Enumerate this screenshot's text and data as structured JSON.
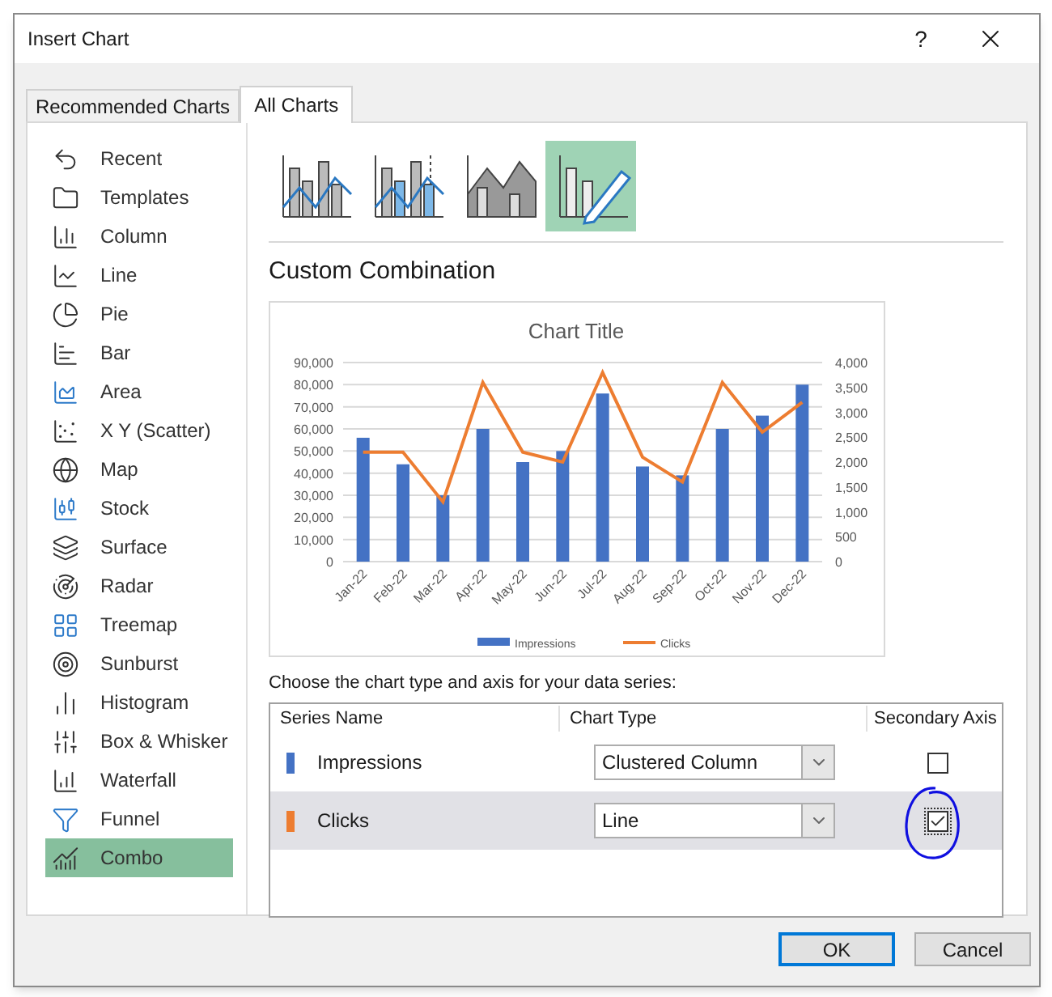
{
  "window": {
    "title": "Insert Chart",
    "help_label": "?"
  },
  "tabs": [
    {
      "label": "Recommended Charts",
      "selected": false
    },
    {
      "label": "All Charts",
      "selected": true
    }
  ],
  "sidebar": {
    "items": [
      {
        "label": "Recent",
        "selected": false
      },
      {
        "label": "Templates",
        "selected": false
      },
      {
        "label": "Column",
        "selected": false
      },
      {
        "label": "Line",
        "selected": false
      },
      {
        "label": "Pie",
        "selected": false
      },
      {
        "label": "Bar",
        "selected": false
      },
      {
        "label": "Area",
        "selected": false
      },
      {
        "label": "X Y (Scatter)",
        "selected": false
      },
      {
        "label": "Map",
        "selected": false
      },
      {
        "label": "Stock",
        "selected": false
      },
      {
        "label": "Surface",
        "selected": false
      },
      {
        "label": "Radar",
        "selected": false
      },
      {
        "label": "Treemap",
        "selected": false
      },
      {
        "label": "Sunburst",
        "selected": false
      },
      {
        "label": "Histogram",
        "selected": false
      },
      {
        "label": "Box & Whisker",
        "selected": false
      },
      {
        "label": "Waterfall",
        "selected": false
      },
      {
        "label": "Funnel",
        "selected": false
      },
      {
        "label": "Combo",
        "selected": true
      }
    ]
  },
  "subtypes": [
    {
      "selected": false
    },
    {
      "selected": false
    },
    {
      "selected": false
    },
    {
      "selected": true
    }
  ],
  "heading": "Custom Combination",
  "preview": {
    "chart_data": {
      "type": "bar",
      "title": "Chart Title",
      "categories": [
        "Jan-22",
        "Feb-22",
        "Mar-22",
        "Apr-22",
        "May-22",
        "Jun-22",
        "Jul-22",
        "Aug-22",
        "Sep-22",
        "Oct-22",
        "Nov-22",
        "Dec-22"
      ],
      "series": [
        {
          "name": "Impressions",
          "color": "#4472c4",
          "values": [
            56000,
            44000,
            30000,
            60000,
            45000,
            50000,
            76000,
            43000,
            39000,
            60000,
            66000,
            80000
          ]
        },
        {
          "name": "Clicks",
          "type": "line",
          "axis": "y2",
          "color": "#ed7d31",
          "values": [
            2200,
            2200,
            1200,
            3600,
            2200,
            2000,
            3800,
            2100,
            1600,
            3600,
            2600,
            3200
          ]
        }
      ],
      "grid": true,
      "legend": "bottom",
      "ylim": [
        0,
        90000
      ],
      "yticks": [
        {
          "value": 0,
          "label": "0"
        },
        {
          "value": 10000,
          "label": "10,000"
        },
        {
          "value": 20000,
          "label": "20,000"
        },
        {
          "value": 30000,
          "label": "30,000"
        },
        {
          "value": 40000,
          "label": "40,000"
        },
        {
          "value": 50000,
          "label": "50,000"
        },
        {
          "value": 60000,
          "label": "60,000"
        },
        {
          "value": 70000,
          "label": "70,000"
        },
        {
          "value": 80000,
          "label": "80,000"
        },
        {
          "value": 90000,
          "label": "90,000"
        }
      ],
      "y2lim": [
        0,
        4000
      ],
      "y2ticks": [
        {
          "value": 0,
          "label": "0"
        },
        {
          "value": 500,
          "label": "500"
        },
        {
          "value": 1000,
          "label": "1,000"
        },
        {
          "value": 1500,
          "label": "1,500"
        },
        {
          "value": 2000,
          "label": "2,000"
        },
        {
          "value": 2500,
          "label": "2,500"
        },
        {
          "value": 3000,
          "label": "3,000"
        },
        {
          "value": 3500,
          "label": "3,500"
        },
        {
          "value": 4000,
          "label": "4,000"
        }
      ]
    }
  },
  "series_table": {
    "instruction": "Choose the chart type and axis for your data series:",
    "columns": [
      "Series Name",
      "Chart Type",
      "Secondary Axis"
    ],
    "rows": [
      {
        "name": "Impressions",
        "color": "#4472c4",
        "chart_type": "Clustered Column",
        "secondary_axis": false,
        "selected": false,
        "circled": false
      },
      {
        "name": "Clicks",
        "color": "#ed7d31",
        "chart_type": "Line",
        "secondary_axis": true,
        "selected": true,
        "circled": true
      }
    ]
  },
  "buttons": [
    {
      "label": "OK",
      "default": true
    },
    {
      "label": "Cancel",
      "default": false
    }
  ]
}
